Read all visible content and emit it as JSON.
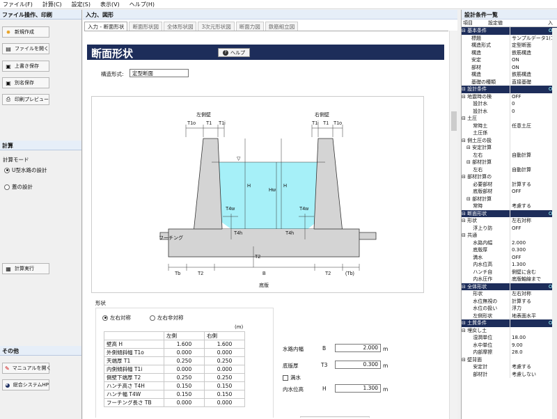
{
  "menu": [
    "ファイル(F)",
    "計算(C)",
    "設定(S)",
    "表示(V)",
    "ヘルプ(H)"
  ],
  "left": {
    "file_section": "ファイル操作、印刷",
    "file_buttons": [
      "新規作成",
      "ファイルを開く",
      "上書き保存",
      "別名保存",
      "印刷プレビュー"
    ],
    "calc_section": "計算",
    "calc_mode_label": "計算モード",
    "calc_modes": [
      "U型水路の設計",
      "蓋の設計"
    ],
    "calc_run": "計算実行",
    "other_section": "その他",
    "other_buttons": [
      "マニュアルを開く",
      "総合システムHP"
    ]
  },
  "main": {
    "header": "入力、図形",
    "tabs": [
      "入力 - 断面形状",
      "断面形状図",
      "全体形状図",
      "3次元形状図",
      "断面力図",
      "鉄筋組立図"
    ],
    "title": "断面形状",
    "help": "ヘルプ",
    "structure_label": "構造形式:",
    "structure_value": "定型断面",
    "diagram": {
      "left_wall": "左側壁",
      "right_wall": "右側壁",
      "t1o": "T1o",
      "t1": "T1",
      "t1i": "T1i",
      "t4w": "T4w",
      "t4h": "T4h",
      "t2": "T2",
      "h": "H",
      "hw": "Hw",
      "footing": "フーチング",
      "tb": "Tb",
      "tb_paren": "(Tb)",
      "b": "B",
      "bottom": "底版"
    },
    "shape_section": "形状",
    "sym_options": [
      "左右対称",
      "左右非対称"
    ],
    "unit": "(m)",
    "grid_headers": [
      "",
      "左側",
      "右側"
    ],
    "grid_rows": [
      [
        "壁高 H",
        "1.600",
        "1.600"
      ],
      [
        "外側傾斜幅 T1o",
        "0.000",
        "0.000"
      ],
      [
        "天端厚 T1",
        "0.250",
        "0.250"
      ],
      [
        "内側傾斜幅 T1i",
        "0.000",
        "0.000"
      ],
      [
        "側壁下端厚 T2",
        "0.250",
        "0.250"
      ],
      [
        "ハンチ高さ T4H",
        "0.150",
        "0.150"
      ],
      [
        "ハンチ幅 T4W",
        "0.150",
        "0.150"
      ],
      [
        "フーチング長さ TB",
        "0.000",
        "0.000"
      ]
    ],
    "inner_width_label": "水路内幅",
    "inner_width_sym": "B",
    "inner_width_value": "2.000",
    "m1": "m",
    "bottom_label": "底版厚",
    "bottom_sym": "T3",
    "bottom_value": "0.300",
    "m2": "m",
    "full_water": "満水",
    "water_label": "内水位高",
    "water_sym": "H",
    "water_value": "1.300",
    "m3": "m"
  },
  "right": {
    "header": "設計条件一覧",
    "col1": "項目",
    "col2": "設定値",
    "col3": "入",
    "rows": [
      {
        "k": "⊟ 基本条件",
        "v": "OK",
        "cat": true
      },
      {
        "k": "　　標題",
        "v": "サンプルデータ1(1"
      },
      {
        "k": "　　構造形式",
        "v": "定型断面"
      },
      {
        "k": "　　構造",
        "v": "鉄筋構造"
      },
      {
        "k": "　　安定",
        "v": "ON"
      },
      {
        "k": "　　部材",
        "v": "ON"
      },
      {
        "k": "　　構造",
        "v": "鉄筋構造"
      },
      {
        "k": "　　基礎の種類",
        "v": "直接基礎"
      },
      {
        "k": "⊟ 設計条件",
        "v": "OK",
        "cat": true
      },
      {
        "k": " ⊟ 地震時の検",
        "v": "OFF"
      },
      {
        "k": "　　 設計水",
        "v": "0"
      },
      {
        "k": "　　 設計水",
        "v": "0"
      },
      {
        "k": " ⊟ 土圧",
        "v": ""
      },
      {
        "k": "　　 常時土",
        "v": "任意土圧"
      },
      {
        "k": "　　 土圧係",
        "v": ""
      },
      {
        "k": " ⊟ 側土圧の扱",
        "v": ""
      },
      {
        "k": "　⊟ 安定計算",
        "v": ""
      },
      {
        "k": "　　 左右",
        "v": "自動計算"
      },
      {
        "k": "　⊟ 部材計算",
        "v": ""
      },
      {
        "k": "　　 左右",
        "v": "自動計算"
      },
      {
        "k": " ⊟ 部材計算の",
        "v": ""
      },
      {
        "k": "　　 必要部材",
        "v": "計算する"
      },
      {
        "k": "　　 底版部材",
        "v": "OFF"
      },
      {
        "k": "　⊟ 部材計算",
        "v": ""
      },
      {
        "k": "　　 常時",
        "v": "考慮する"
      },
      {
        "k": "⊟ 断面形状",
        "v": "OK",
        "cat": true
      },
      {
        "k": " ⊟ 形状",
        "v": "左右対称"
      },
      {
        "k": "　　 浮上り防",
        "v": "OFF"
      },
      {
        "k": " ⊟ 共通",
        "v": ""
      },
      {
        "k": "　　 水路内幅",
        "v": "2.000"
      },
      {
        "k": "　　 底版厚",
        "v": "0.300"
      },
      {
        "k": "　　 満水",
        "v": "OFF"
      },
      {
        "k": "　　 内水位高",
        "v": "1.300"
      },
      {
        "k": "　　 ハンチ自",
        "v": "側壁に含む"
      },
      {
        "k": "　　 内水圧作",
        "v": "底版軸線まで"
      },
      {
        "k": "⊟ 全体形状",
        "v": "OK",
        "cat": true
      },
      {
        "k": "　　 形状",
        "v": "左右対称"
      },
      {
        "k": "　　 水位無視の",
        "v": "計算する"
      },
      {
        "k": "　　 水位の扱い",
        "v": "浮力"
      },
      {
        "k": "　　 左側形状",
        "v": "地表面水平"
      },
      {
        "k": "⊟ 土質条件",
        "v": "OK",
        "cat": true
      },
      {
        "k": " ⊟ 埋戻し土",
        "v": ""
      },
      {
        "k": "　　 湿潤単位",
        "v": "18.00"
      },
      {
        "k": "　　 水中単位",
        "v": "9.00"
      },
      {
        "k": "　　 内部摩擦",
        "v": "28.0"
      },
      {
        "k": " ⊟ 壁背面",
        "v": ""
      },
      {
        "k": "　　 安定計",
        "v": "考慮する"
      },
      {
        "k": "　　 部材計",
        "v": "考慮しない"
      }
    ]
  }
}
